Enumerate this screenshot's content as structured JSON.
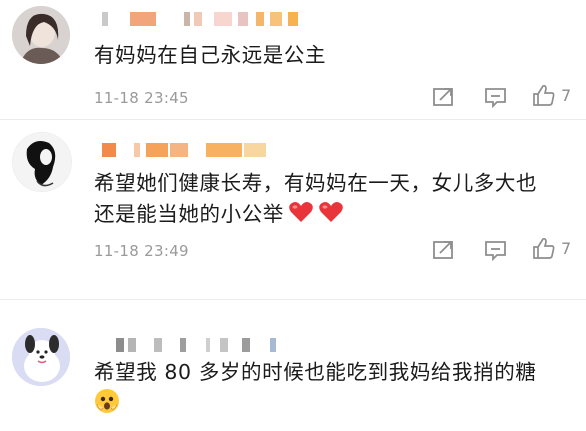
{
  "comments": [
    {
      "text_lines": [
        "有妈妈在自己永远是公主"
      ],
      "time": "11-18 23:45",
      "likes": "7",
      "username": "",
      "avatar": "avatar-woman-portrait"
    },
    {
      "text_lines": [
        "希望她们健康长寿，有妈妈在一天，女儿多大也",
        "还是能当她的小公举"
      ],
      "time": "11-18 23:49",
      "likes": "7",
      "username": "",
      "avatar": "avatar-dark-hair-silhouette",
      "emojis": [
        "red-heart",
        "red-heart"
      ]
    },
    {
      "text_lines": [
        "希望我 80 多岁的时候也能吃到我妈给我捎的糖"
      ],
      "time": "",
      "likes": "",
      "username": "",
      "avatar": "avatar-cartoon-dog",
      "emojis": [
        "scared-face"
      ]
    }
  ],
  "icons": {
    "forward": "share-forward-icon",
    "comment": "comment-bubble-icon",
    "like": "thumbs-up-icon"
  },
  "colors": {
    "text": "#1b1b1b",
    "meta": "#9a9a9a",
    "heart": "#e8343b",
    "name_blur_orange": "#f5a25a"
  }
}
